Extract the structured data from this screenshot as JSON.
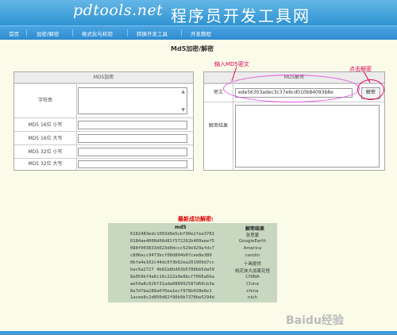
{
  "header": {
    "logo": "pdtools.net",
    "title": "程序员开发工具网"
  },
  "nav": [
    "首页",
    "加密/解密",
    "格式化与校验",
    "转换开发工具",
    "开发教程"
  ],
  "page_title": "Md5加密/解密",
  "encrypt_panel": {
    "heading": "MD5加密",
    "string_label": "字符串",
    "rows": [
      "MD5 16位 小写",
      "MD5 16位 大写",
      "MD5 32位 小写",
      "MD5 32位 大写"
    ]
  },
  "decrypt_panel": {
    "heading": "MD5解密",
    "cipher_label": "密文",
    "cipher_value": "ede56303adec3c37e6cd010b84093b8e",
    "decrypt_button": "解密",
    "result_label": "解密结果"
  },
  "annotations": {
    "input_hint": "输入MD5密文",
    "click_hint": "点击解密"
  },
  "recent": {
    "title": "最新成功解密:",
    "headers": [
      "md5",
      "解密结果"
    ],
    "rows": [
      [
        "6182483edc1003d0e5cbf90e2fea3781",
        "张思蒙"
      ],
      [
        "0184ae4008d06d81f572262b409aeef5",
        "GoogleEarth"
      ],
      [
        "088f003833d023d0dccc529e929afdc7",
        "America"
      ],
      [
        "c806ecc9473bcf08d804b07cee8e380",
        "carolin"
      ],
      [
        "0bfa4e102c44dc0f3b62ea201909d7cc",
        "十画提供"
      ],
      [
        "bac6a2727 4b81b8bd63b5788bb5da59",
        "桃花侠大战葛花怪"
      ],
      [
        "8a059bf4a6c16c222a9e8bcf7066a6ba",
        "CHINA"
      ],
      [
        "ae54a8c026f31ada088992587d60cb3a",
        "China"
      ],
      [
        "8a7d7ba288a0f0ea1ecf978b028e6e1",
        "china"
      ],
      [
        "1acee8c2d850d82f90b9b7378be5294d",
        "niuh"
      ]
    ]
  },
  "watermark": "Baidu经验"
}
